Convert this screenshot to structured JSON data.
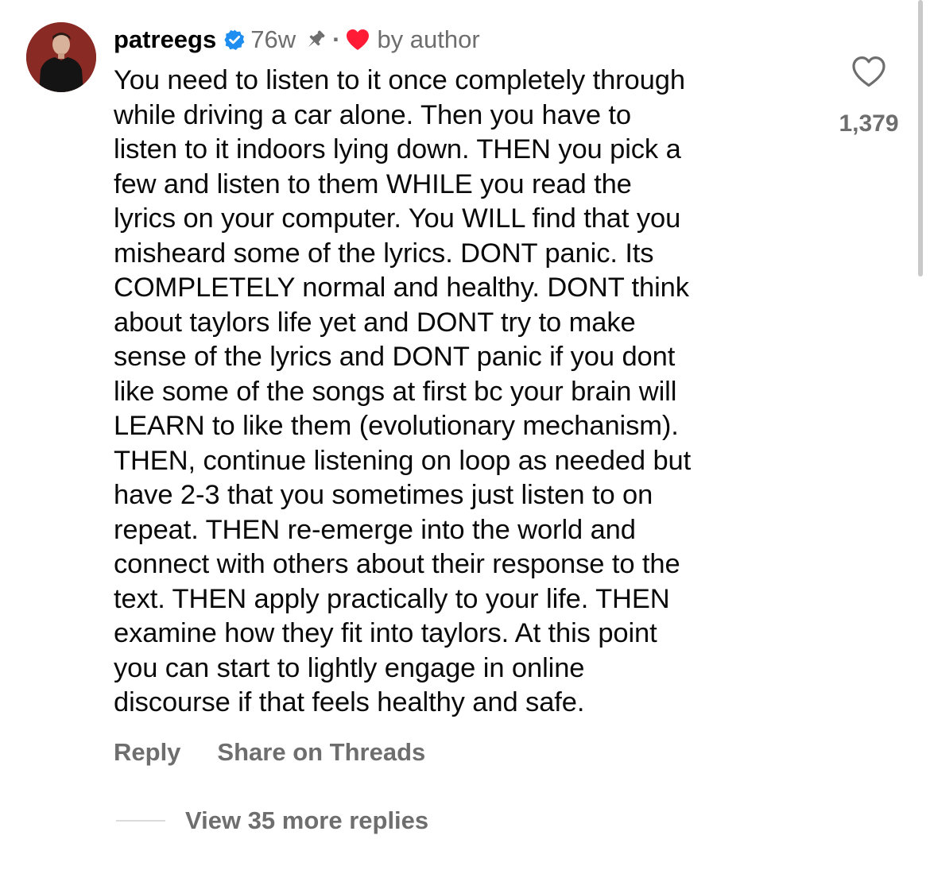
{
  "comment": {
    "username": "patreegs",
    "time": "76w",
    "separator": "·",
    "by_author": "by author",
    "lines": [
      "You need to listen to it once completely through",
      "while driving a car alone. Then you have to",
      "listen to it indoors lying down. THEN you pick a",
      "few and listen to them WHILE you read the",
      "lyrics on your computer. You WILL find that you",
      "misheard some of the lyrics. DONT panic. Its",
      "COMPLETELY normal and healthy. DONT think",
      "about taylors life yet and DONT try to make",
      "sense of the lyrics and DONT panic if you dont",
      "like some of the songs at first bc your brain will",
      "LEARN to like them (evolutionary mechanism).",
      "THEN, continue listening on loop as needed but",
      "have 2-3 that you sometimes just listen to on",
      "repeat. THEN re-emerge into the world and",
      "connect with others about their response to the",
      "text. THEN apply practically to your life. THEN",
      "examine how they fit into taylors. At this point",
      "you can start to lightly engage in online",
      "discourse if that feels healthy and safe."
    ],
    "like_count": "1,379",
    "reply_label": "Reply",
    "share_label": "Share on Threads",
    "view_replies_label": "View 35 more replies"
  },
  "icons": {
    "avatar": "profile-avatar",
    "verified": "verified-badge-icon",
    "pin": "pin-icon",
    "author_like": "heart-filled-icon",
    "like": "heart-outline-icon"
  },
  "colors": {
    "verified_blue": "#1f8ef1",
    "author_heart_red": "#ff1a35",
    "secondary_text": "#6e6e6e",
    "avatar_bg": "#8a2a25"
  }
}
